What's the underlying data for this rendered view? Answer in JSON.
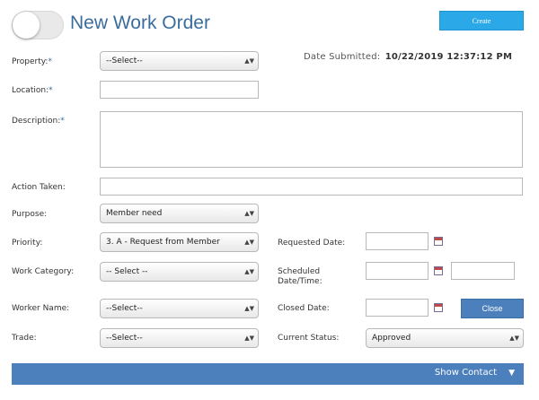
{
  "header": {
    "title": "New Work Order",
    "create_label": "Create"
  },
  "date_submitted": {
    "label": "Date Submitted:",
    "value": "10/22/2019 12:37:12 PM"
  },
  "fields": {
    "property": {
      "label": "Property:",
      "required": "*",
      "value": "--Select--"
    },
    "location": {
      "label": "Location:",
      "required": "*",
      "value": ""
    },
    "description": {
      "label": "Description:",
      "required": "*",
      "value": ""
    },
    "action_taken": {
      "label": "Action Taken:",
      "value": ""
    },
    "purpose": {
      "label": "Purpose:",
      "value": "Member need"
    },
    "priority": {
      "label": "Priority:",
      "value": "3. A - Request from Member"
    },
    "work_category": {
      "label": "Work Category:",
      "value": "-- Select --"
    },
    "worker_name": {
      "label": "Worker Name:",
      "value": "--Select--"
    },
    "trade": {
      "label": "Trade:",
      "value": "--Select--"
    },
    "requested_date": {
      "label": "Requested Date:",
      "value": ""
    },
    "scheduled_date": {
      "label": "Scheduled Date/Time:",
      "date": "",
      "time": ""
    },
    "closed_date": {
      "label": "Closed Date:",
      "value": "",
      "close_label": "Close"
    },
    "current_status": {
      "label": "Current Status:",
      "value": "Approved"
    }
  },
  "show_contact": {
    "label": "Show Contact"
  },
  "icons": {
    "select_arrow": "updown-arrow-icon",
    "calendar": "calendar-icon",
    "chevron": "chevron-down-icon"
  },
  "colors": {
    "title": "#3a6d9e",
    "create_button": "#2aa8e8",
    "primary_button": "#4b80bd"
  }
}
